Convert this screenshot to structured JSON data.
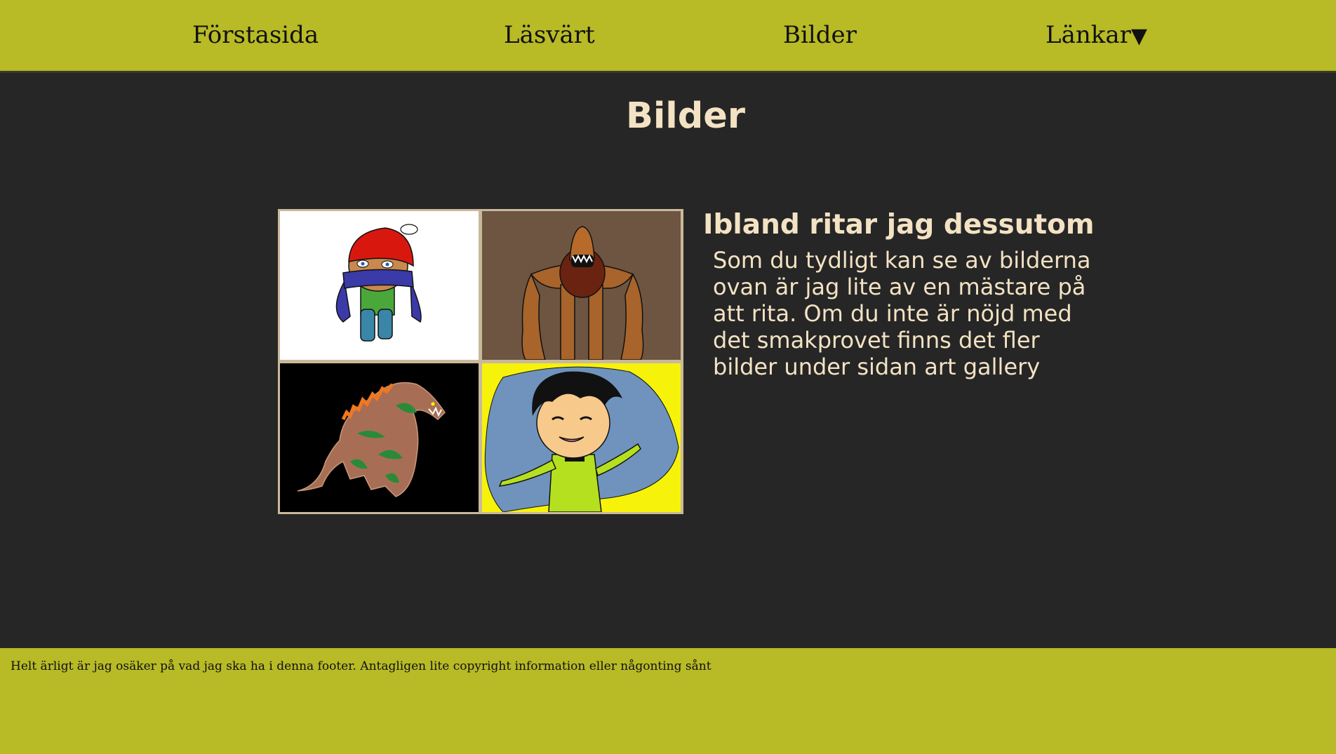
{
  "nav": {
    "items": [
      {
        "label": "Förstasida"
      },
      {
        "label": "Läsvärt"
      },
      {
        "label": "Bilder"
      },
      {
        "label": "Länkar",
        "dropdown_glyph": "▼"
      }
    ]
  },
  "page": {
    "title": "Bilder"
  },
  "gallery": {
    "images": [
      {
        "name": "drawing-scarf-character"
      },
      {
        "name": "drawing-brown-monster"
      },
      {
        "name": "drawing-dinosaur"
      },
      {
        "name": "drawing-smiling-boy"
      }
    ]
  },
  "aside": {
    "heading": "Ibland ritar jag dessutom",
    "text": "Som du tydligt kan se av bilderna ovan är jag lite av en mästare på att rita. Om du inte är nöjd med det smakprovet finns det fler bilder under sidan art gallery"
  },
  "footer": {
    "text": "Helt ärligt är jag osäker på vad jag ska ha i denna footer. Antagligen lite copyright information eller någonting sånt"
  },
  "colors": {
    "nav_bg": "#b8ba26",
    "page_bg": "#262626",
    "text_light": "#f3e2c3",
    "gallery_border": "#c9b99b"
  }
}
